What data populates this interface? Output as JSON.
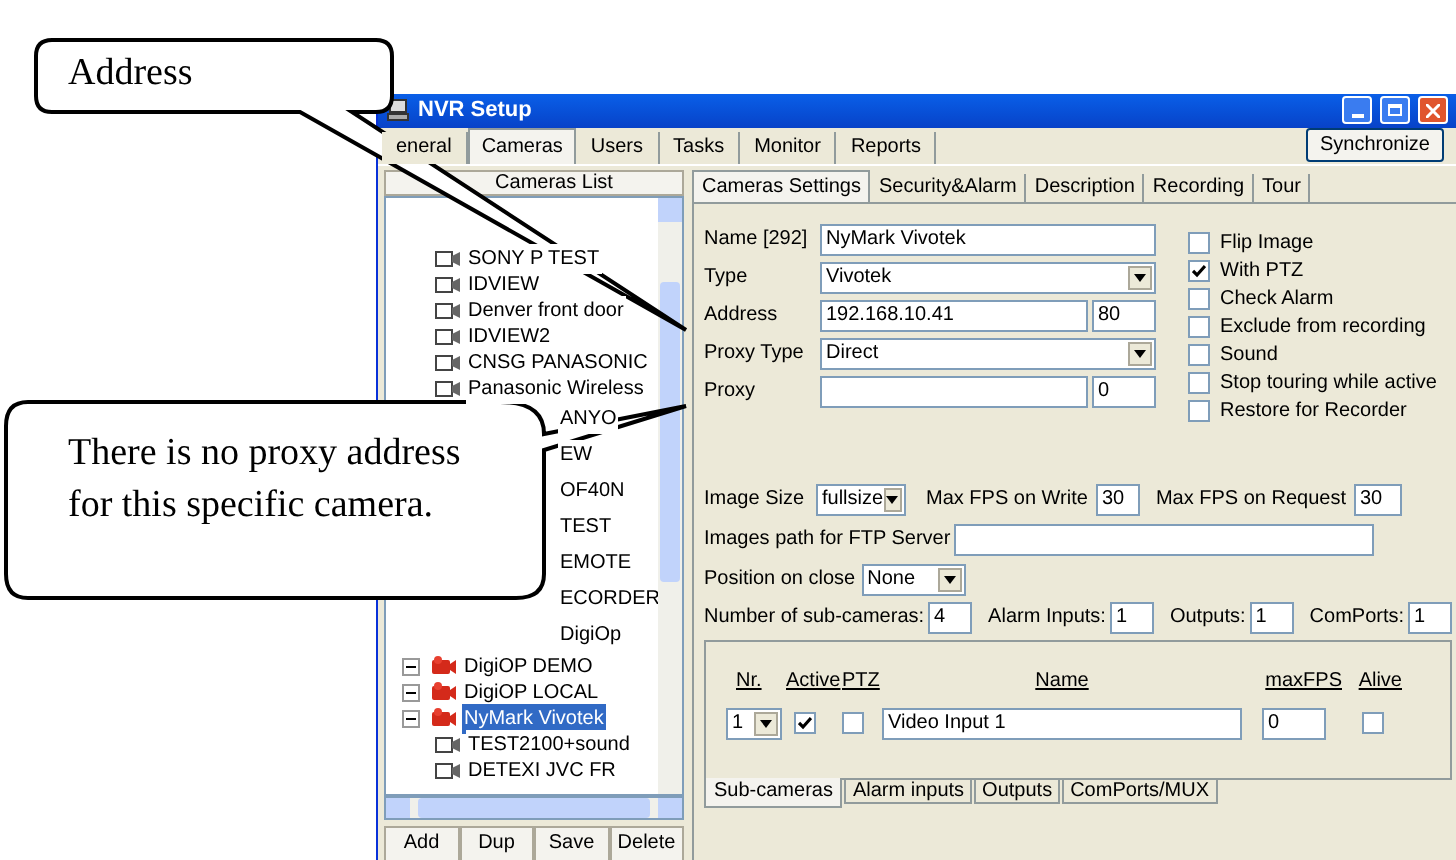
{
  "window": {
    "title": "NVR Setup"
  },
  "main_tabs": [
    {
      "label": "eneral",
      "selected": false
    },
    {
      "label": "Cameras",
      "selected": true
    },
    {
      "label": "Users",
      "selected": false
    },
    {
      "label": "Tasks",
      "selected": false
    },
    {
      "label": "Monitor",
      "selected": false
    },
    {
      "label": "Reports",
      "selected": false
    }
  ],
  "synchronize_button": "Synchronize",
  "cameras_list": {
    "header": "Cameras List",
    "items": [
      {
        "label": "SONY P TEST",
        "kind": "camera",
        "selected": false
      },
      {
        "label": "IDVIEW",
        "kind": "camera",
        "selected": false
      },
      {
        "label": "Denver front door",
        "kind": "camera",
        "selected": false
      },
      {
        "label": "IDVIEW2",
        "kind": "camera",
        "selected": false
      },
      {
        "label": "CNSG PANASONIC",
        "kind": "camera",
        "selected": false
      },
      {
        "label": "Panasonic Wireless",
        "kind": "camera",
        "selected": false
      },
      {
        "label": "ANYO",
        "kind": "cut",
        "selected": false
      },
      {
        "label": "EW",
        "kind": "cut",
        "selected": false
      },
      {
        "label": "OF40N",
        "kind": "cut",
        "selected": false
      },
      {
        "label": "TEST",
        "kind": "cut",
        "selected": false
      },
      {
        "label": "EMOTE",
        "kind": "cut",
        "selected": false
      },
      {
        "label": "ECORDER",
        "kind": "cut",
        "selected": false
      },
      {
        "label": "DigiOp",
        "kind": "cut",
        "selected": false
      },
      {
        "label": "DigiOP DEMO",
        "kind": "group",
        "selected": false
      },
      {
        "label": "DigiOP LOCAL",
        "kind": "group",
        "selected": false
      },
      {
        "label": "NyMark Vivotek",
        "kind": "group",
        "selected": true
      },
      {
        "label": "TEST2100+sound",
        "kind": "camera",
        "selected": false
      },
      {
        "label": "DETEXI JVC FR",
        "kind": "camera",
        "selected": false
      }
    ],
    "buttons": [
      "Add",
      "Dup",
      "Save",
      "Delete"
    ]
  },
  "settings_tabs": [
    {
      "label": "Cameras Settings",
      "selected": true
    },
    {
      "label": "Security&Alarm",
      "selected": false
    },
    {
      "label": "Description",
      "selected": false
    },
    {
      "label": "Recording",
      "selected": false
    },
    {
      "label": "Tour",
      "selected": false
    }
  ],
  "form": {
    "fields": [
      {
        "label": "Name [292]",
        "value": "NyMark Vivotek",
        "kind": "text"
      },
      {
        "label": "Type",
        "value": "Vivotek",
        "kind": "select"
      },
      {
        "label": "Address",
        "value": "192.168.10.41",
        "kind": "text",
        "port": "80"
      },
      {
        "label": "Proxy Type",
        "value": "Direct",
        "kind": "select"
      },
      {
        "label": "Proxy",
        "kind": "text",
        "port": "0"
      }
    ],
    "checkboxes": [
      {
        "label": "Flip Image",
        "checked": false
      },
      {
        "label": "With PTZ",
        "checked": true
      },
      {
        "label": "Check Alarm",
        "checked": false
      },
      {
        "label": "Exclude from recording",
        "checked": false
      },
      {
        "label": "Sound",
        "checked": false
      },
      {
        "label": "Stop touring while active",
        "checked": false
      },
      {
        "label": "Restore for Recorder",
        "checked": false
      }
    ]
  },
  "image_size": {
    "label": "Image Size",
    "value": "fullsize"
  },
  "max_fps_write": {
    "label": "Max FPS on Write",
    "value": "30"
  },
  "max_fps_request": {
    "label": "Max FPS on Request",
    "value": "30"
  },
  "ftp_path": {
    "label": "Images path for FTP Server"
  },
  "position_on_close": {
    "label": "Position on close",
    "value": "None"
  },
  "counts": [
    {
      "label": "Number of sub-cameras:",
      "value": "4"
    },
    {
      "label": "Alarm Inputs:",
      "value": "1"
    },
    {
      "label": "Outputs:",
      "value": "1"
    },
    {
      "label": "ComPorts:",
      "value": "1"
    }
  ],
  "sub_cameras": {
    "columns": [
      "Nr.",
      "Active",
      "PTZ",
      "Name",
      "maxFPS",
      "Alive"
    ],
    "rows": [
      {
        "nr": "1",
        "active": true,
        "ptz": false,
        "name": "Video Input 1",
        "max_fps": "0",
        "alive": false
      }
    ],
    "tabs": [
      {
        "label": "Sub-cameras",
        "selected": true
      },
      {
        "label": "Alarm inputs",
        "selected": false
      },
      {
        "label": "Outputs",
        "selected": false
      },
      {
        "label": "ComPorts/MUX",
        "selected": false
      }
    ]
  },
  "callouts": [
    {
      "text": "Address"
    },
    {
      "text": "There is no proxy address for this specific camera."
    }
  ]
}
